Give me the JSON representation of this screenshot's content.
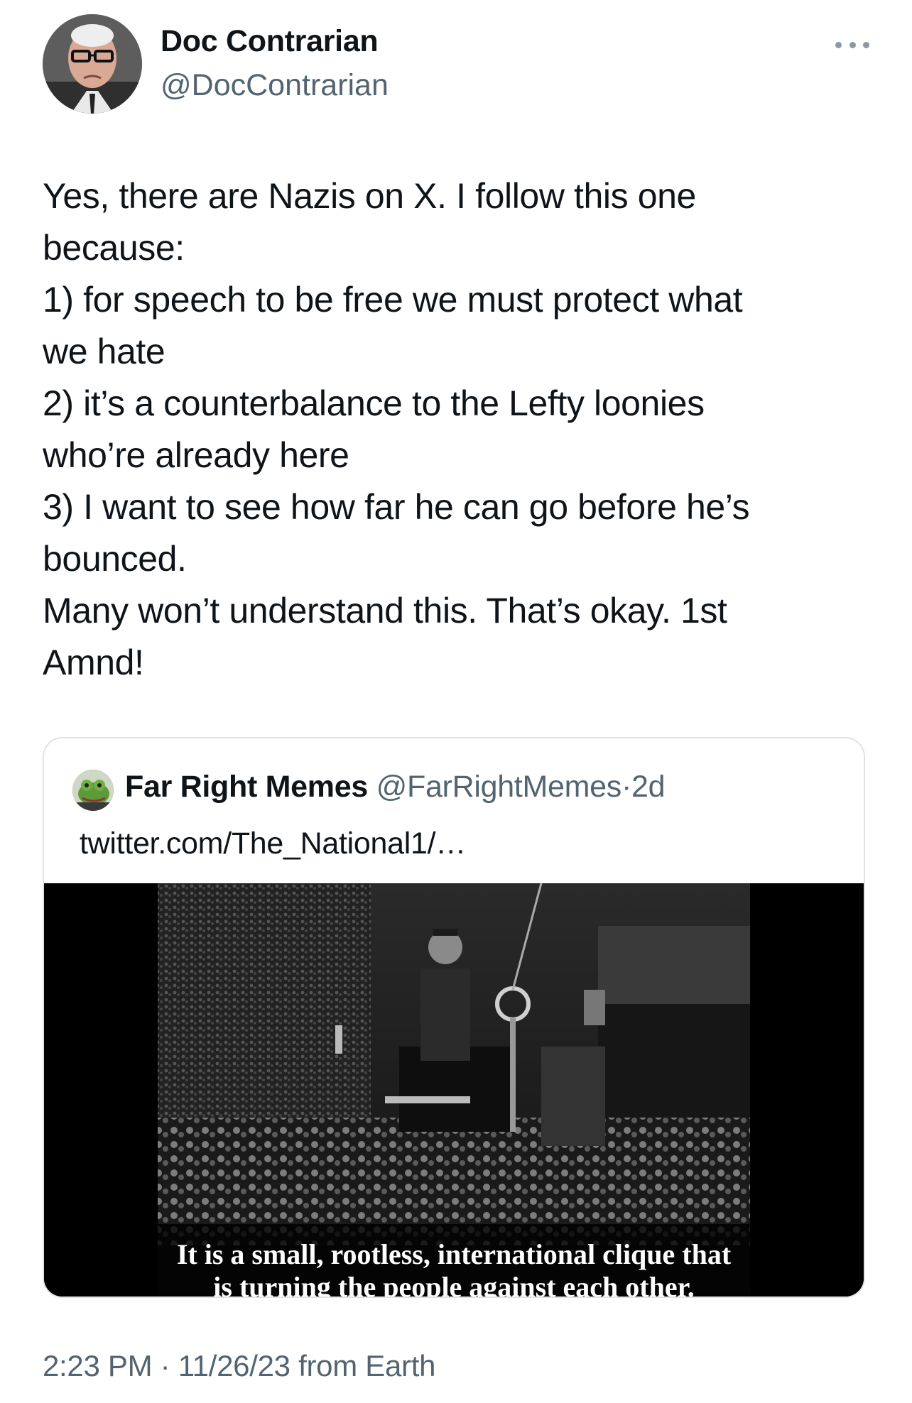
{
  "post": {
    "author": {
      "name": "Doc Contrarian",
      "handle": "@DocContrarian",
      "avatar_icon": "profile-photo"
    },
    "more_icon": "more-horizontal-icon",
    "body_lines": [
      "Yes, there are Nazis on X. I follow this one",
      "because:",
      "1) for speech to be free we must protect what",
      "we hate",
      "2) it’s a counterbalance to the Lefty loonies",
      "who’re already here",
      "3) I want to see how far he can go before he’s",
      "bounced.",
      "Many won’t understand this. That’s okay. 1st",
      "Amnd!"
    ],
    "timestamp": "2:23 PM · 11/26/23 from Earth"
  },
  "quoted": {
    "name": "Far Right Memes",
    "handle": "@FarRightMemes",
    "separator": "·",
    "age": "2d",
    "text": "twitter.com/The_National1/…",
    "media": {
      "type": "video-still",
      "caption_line1": "It is a small, rootless, international clique that",
      "caption_line2": "is turning the people against each other."
    }
  }
}
